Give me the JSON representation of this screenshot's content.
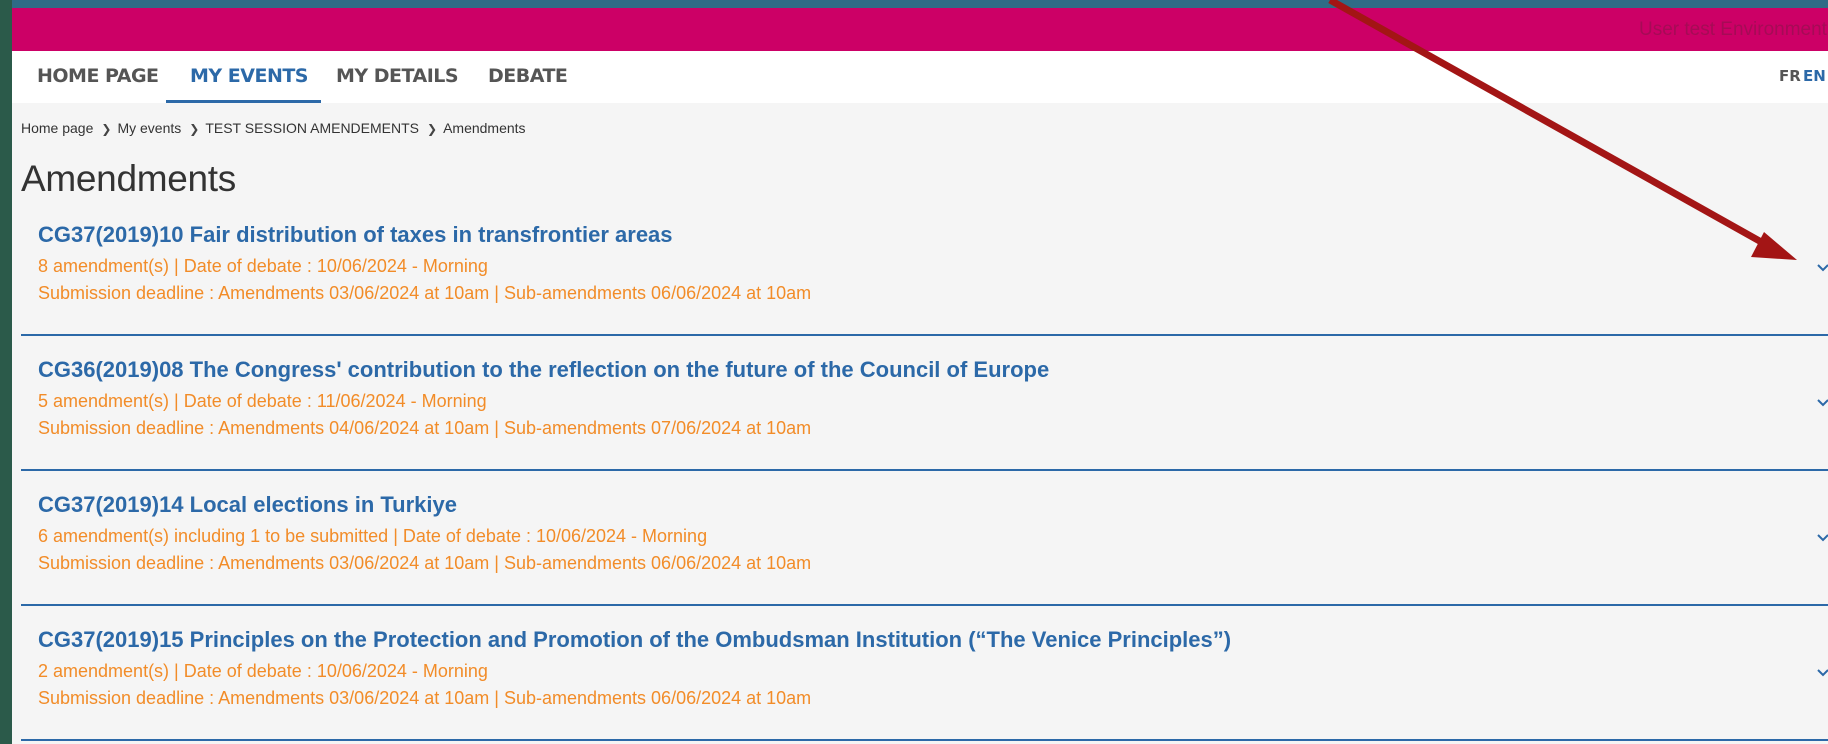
{
  "environment_label": "User test Environment",
  "nav": {
    "items": [
      {
        "label": "HOME PAGE",
        "active": false
      },
      {
        "label": "MY EVENTS",
        "active": true
      },
      {
        "label": "MY DETAILS",
        "active": false
      },
      {
        "label": "DEBATE",
        "active": false
      }
    ],
    "languages": [
      {
        "code": "FR",
        "active": false
      },
      {
        "code": "EN",
        "active": true
      }
    ]
  },
  "breadcrumb": [
    "Home page",
    "My events",
    "TEST SESSION AMENDEMENTS",
    "Amendments"
  ],
  "page_title": "Amendments",
  "items": [
    {
      "title": "CG37(2019)10 Fair distribution of taxes in transfrontier areas",
      "line1": "8 amendment(s) | Date of debate : 10/06/2024 - Morning",
      "line2": "Submission deadline : Amendments 03/06/2024 at 10am | Sub-amendments 06/06/2024 at 10am"
    },
    {
      "title": "CG36(2019)08 The Congress' contribution to the reflection on the future of the Council of Europe",
      "line1": "5 amendment(s) | Date of debate : 11/06/2024 - Morning",
      "line2": "Submission deadline : Amendments 04/06/2024 at 10am | Sub-amendments 07/06/2024 at 10am"
    },
    {
      "title": "CG37(2019)14 Local elections in Turkiye",
      "line1": "6 amendment(s) including 1 to be submitted | Date of debate : 10/06/2024 - Morning",
      "line2": "Submission deadline : Amendments 03/06/2024 at 10am | Sub-amendments 06/06/2024 at 10am"
    },
    {
      "title": "CG37(2019)15 Principles on the Protection and Promotion of the Ombudsman Institution (“The Venice Principles”)",
      "line1": "2 amendment(s) | Date of debate : 10/06/2024 - Morning",
      "line2": "Submission deadline : Amendments 03/06/2024 at 10am | Sub-amendments 06/06/2024 at 10am"
    }
  ],
  "colors": {
    "brand_magenta": "#cc0066",
    "primary_blue": "#2c69a8",
    "accent_orange": "#f28c28",
    "annotation_arrow": "#a31515"
  }
}
